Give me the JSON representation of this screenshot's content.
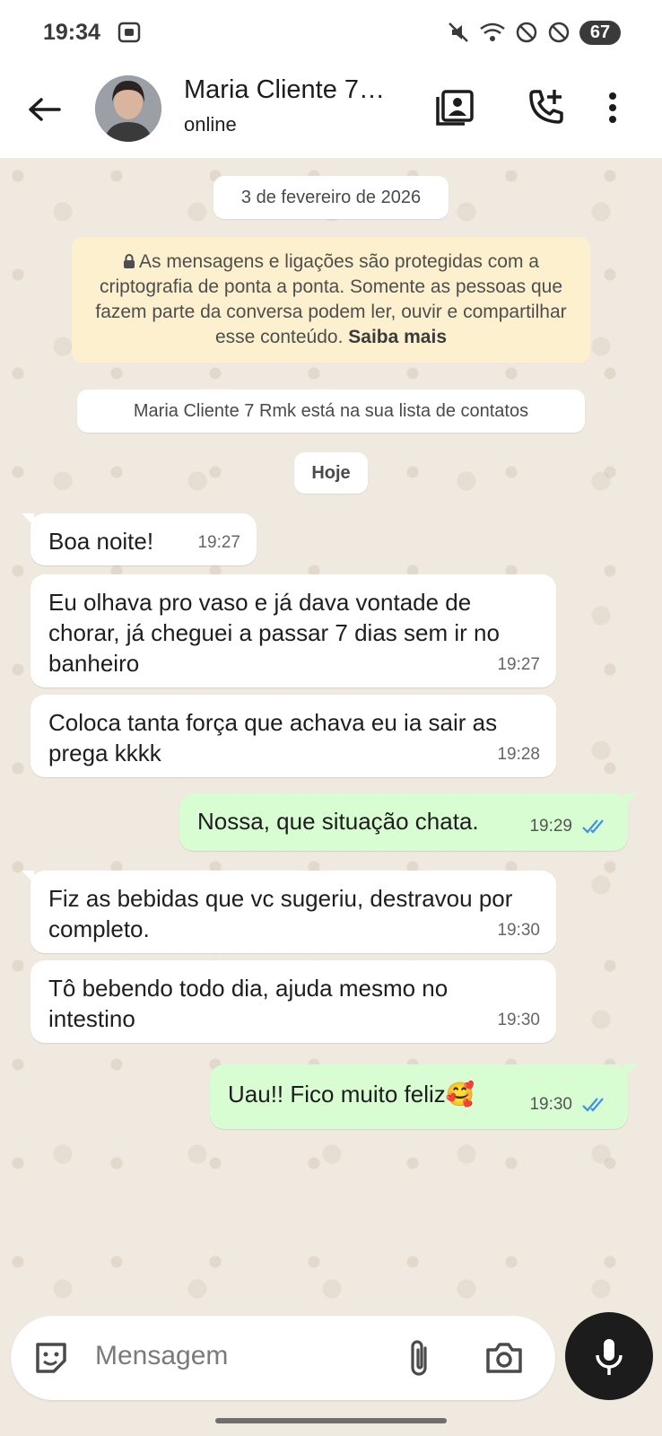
{
  "status_bar": {
    "time": "19:34",
    "battery": "67",
    "icons": [
      "screen-record-icon",
      "mute-icon",
      "wifi-icon",
      "blocked-icon",
      "blocked-icon"
    ]
  },
  "header": {
    "contact_name": "Maria Cliente 7…",
    "presence": "online",
    "icons": [
      "back-arrow-icon",
      "contact-card-icon",
      "add-call-icon",
      "more-vert-icon"
    ]
  },
  "chat": {
    "date_pill": "3 de fevereiro de 2026",
    "encryption": {
      "text": "As mensagens e ligações são protegidas com a criptografia de ponta a ponta. Somente as pessoas que fazem parte da conversa podem ler, ouvir e compartilhar esse conteúdo.",
      "link": "Saiba mais"
    },
    "contact_notice": "Maria Cliente 7 Rmk está na sua lista de contatos",
    "today_pill": "Hoje",
    "messages": [
      {
        "dir": "in",
        "text": "Boa noite!",
        "time": "19:27"
      },
      {
        "dir": "in",
        "text": "Eu olhava pro vaso e já dava vontade de chorar, já cheguei a passar 7 dias sem ir no banheiro",
        "time": "19:27"
      },
      {
        "dir": "in",
        "text": "Coloca tanta força que achava eu ia sair as prega kkkk",
        "time": "19:28"
      },
      {
        "dir": "out",
        "text": "Nossa, que situação chata.",
        "time": "19:29",
        "status": "read"
      },
      {
        "dir": "in",
        "text": "Fiz as bebidas que vc sugeriu, destravou por completo.",
        "time": "19:30"
      },
      {
        "dir": "in",
        "text": "Tô bebendo todo dia, ajuda mesmo no intestino",
        "time": "19:30"
      },
      {
        "dir": "out",
        "text": "Uau!! Fico muito feliz🥰",
        "time": "19:30",
        "status": "read"
      }
    ]
  },
  "composer": {
    "placeholder": "Mensagem",
    "icons": [
      "sticker-icon",
      "attach-icon",
      "camera-icon",
      "mic-icon"
    ]
  },
  "colors": {
    "chat_bg": "#efe9e0",
    "incoming_bubble": "#ffffff",
    "outgoing_bubble": "#d9fdd3",
    "encryption_bg": "#fdf0cf",
    "read_ticks": "#3d8ff0"
  }
}
